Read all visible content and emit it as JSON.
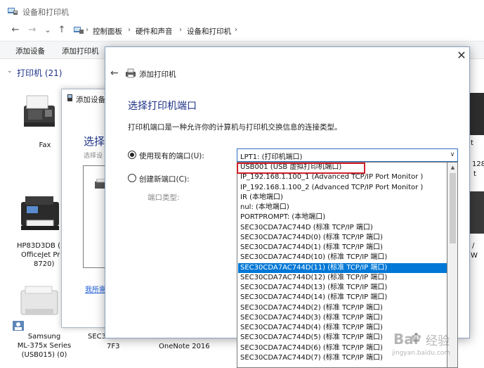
{
  "window": {
    "title": "设备和打印机",
    "nav": {
      "back": "←",
      "forward": "→",
      "down": "⌄",
      "up": "↑"
    },
    "breadcrumb": [
      "控制面板",
      "硬件和声音",
      "设备和打印机"
    ],
    "breadcrumb_sep": "›",
    "commands": [
      "添加设备",
      "添加打印机"
    ],
    "printers_header": "打印机 (21)"
  },
  "devices": [
    {
      "label": "Fax"
    },
    {
      "label_lines": [
        "HP83D3DB (",
        "OfficeJet Pr",
        "8720)"
      ]
    },
    {
      "label_lines": [
        "Samsung",
        "ML-375x Series",
        "(USB015) (0)"
      ]
    },
    {
      "label": "SEC3"
    },
    {
      "label": "7F3"
    },
    {
      "label": "OneNote 2016"
    }
  ],
  "right_clip": [
    "t",
    "128",
    "t",
    "/",
    "W"
  ],
  "dialog_back": {
    "title": "添加设备",
    "heading": "选择",
    "sub": "选择设",
    "link": "我所需"
  },
  "dialog": {
    "title": "添加打印机",
    "close": "✕",
    "back": "←",
    "heading": "选择打印机端口",
    "description": "打印机端口是一种允许你的计算机与打印机交换信息的连接类型。",
    "radio_existing": "使用现有的端口(U):",
    "radio_new": "创建新端口(C):",
    "port_type_label": "端口类型:",
    "combo_value": "LPT1: (打印机端口)",
    "options": [
      "USB001 (USB 虚拟打印机端口)",
      "IP_192.168.1.100_1 (Advanced TCP/IP Port Monitor )",
      "IP_192.168.1.100_2 (Advanced TCP/IP Port Monitor )",
      "IR (本地端口)",
      "nul: (本地端口)",
      "PORTPROMPT: (本地端口)",
      "SEC30CDA7AC744D (标准 TCP/IP 端口)",
      "SEC30CDA7AC744D(0) (标准 TCP/IP 端口)",
      "SEC30CDA7AC744D(1) (标准 TCP/IP 端口)",
      "SEC30CDA7AC744D(10) (标准 TCP/IP 端口)",
      "SEC30CDA7AC744D(11) (标准 TCP/IP 端口)",
      "SEC30CDA7AC744D(12) (标准 TCP/IP 端口)",
      "SEC30CDA7AC744D(13) (标准 TCP/IP 端口)",
      "SEC30CDA7AC744D(14) (标准 TCP/IP 端口)",
      "SEC30CDA7AC744D(2) (标准 TCP/IP 端口)",
      "SEC30CDA7AC744D(3) (标准 TCP/IP 端口)",
      "SEC30CDA7AC744D(4) (标准 TCP/IP 端口)",
      "SEC30CDA7AC744D(5) (标准 TCP/IP 端口)",
      "SEC30CDA7AC744D(6) (标准 TCP/IP 端口)",
      "SEC30CDA7AC744D(7) (标准 TCP/IP 端口)"
    ],
    "selected_index": 10,
    "outlined_index": 0
  },
  "watermark": {
    "logo": "Bai",
    "text": "经验",
    "url": "jingyan.baidu.com"
  },
  "colors": {
    "accent": "#0078d7",
    "heading": "#1e3287",
    "highlight_outline": "#d0202a"
  }
}
